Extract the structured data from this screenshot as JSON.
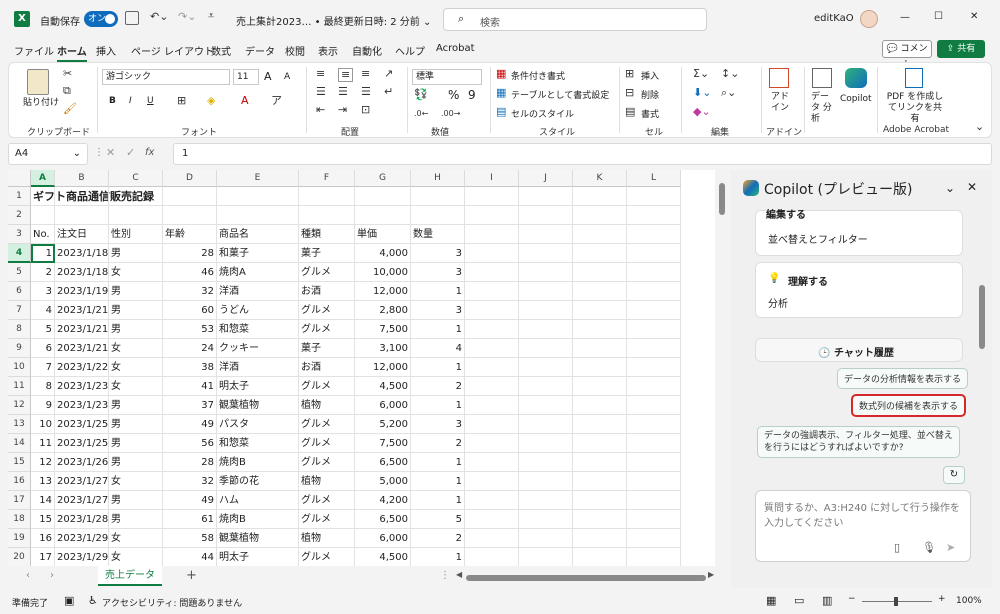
{
  "titlebar": {
    "autosave_label": "自動保存",
    "autosave_state": "オン",
    "doc_title": "売上集計2023… • 最終更新日時: 2 分前 ⌄",
    "search_placeholder": "検索",
    "user_name": "editKaO",
    "min": "—",
    "max": "☐",
    "close": "✕"
  },
  "menu": {
    "items": [
      "ファイル",
      "ホーム",
      "挿入",
      "ページ レイアウト",
      "数式",
      "データ",
      "校閲",
      "表示",
      "自動化",
      "ヘルプ",
      "Acrobat"
    ],
    "comment": "コメント",
    "share": "共有"
  },
  "ribbon": {
    "clipboard": {
      "paste": "貼り付け",
      "label": "クリップボード"
    },
    "font": {
      "name": "游ゴシック",
      "size": "11",
      "label": "フォント",
      "bold": "B",
      "italic": "I",
      "underline": "U",
      "grow": "A",
      "shrink": "A"
    },
    "alignment": {
      "label": "配置"
    },
    "number": {
      "format": "標準",
      "label": "数値",
      "percent": "%",
      "comma": "9"
    },
    "styles": {
      "conditional": "条件付き書式",
      "table": "テーブルとして書式設定",
      "cell_styles": "セルのスタイル",
      "label": "スタイル"
    },
    "cells": {
      "insert": "挿入",
      "delete": "削除",
      "format": "書式",
      "label": "セル"
    },
    "editing": {
      "label": "編集"
    },
    "ideas": {
      "label": "アドイン",
      "button": "アド イン"
    },
    "analysis": {
      "button": "データ 分析"
    },
    "copilot": {
      "button": "Copilot"
    },
    "acrobat": {
      "button": "PDF を作成し てリンクを共有",
      "label": "Adobe Acrobat"
    }
  },
  "formula_bar": {
    "name_box": "A4",
    "fx": "fx",
    "value": "1"
  },
  "grid": {
    "columns": [
      "A",
      "B",
      "C",
      "D",
      "E",
      "F",
      "G",
      "H",
      "I",
      "J",
      "K",
      "L"
    ],
    "title": "ギフト商品通信販売記録",
    "headers": [
      "No.",
      "注文日",
      "性別",
      "年齢",
      "商品名",
      "種類",
      "単価",
      "数量"
    ],
    "rows": [
      [
        "1",
        "2023/1/18",
        "男",
        "28",
        "和菓子",
        "菓子",
        "4,000",
        "3"
      ],
      [
        "2",
        "2023/1/18",
        "女",
        "46",
        "焼肉A",
        "グルメ",
        "10,000",
        "3"
      ],
      [
        "3",
        "2023/1/19",
        "男",
        "32",
        "洋酒",
        "お酒",
        "12,000",
        "1"
      ],
      [
        "4",
        "2023/1/21",
        "男",
        "60",
        "うどん",
        "グルメ",
        "2,800",
        "3"
      ],
      [
        "5",
        "2023/1/21",
        "男",
        "53",
        "和惣菜",
        "グルメ",
        "7,500",
        "1"
      ],
      [
        "6",
        "2023/1/21",
        "女",
        "24",
        "クッキー",
        "菓子",
        "3,100",
        "4"
      ],
      [
        "7",
        "2023/1/22",
        "女",
        "38",
        "洋酒",
        "お酒",
        "12,000",
        "1"
      ],
      [
        "8",
        "2023/1/23",
        "女",
        "41",
        "明太子",
        "グルメ",
        "4,500",
        "2"
      ],
      [
        "9",
        "2023/1/23",
        "男",
        "37",
        "観葉植物",
        "植物",
        "6,000",
        "1"
      ],
      [
        "10",
        "2023/1/25",
        "男",
        "49",
        "パスタ",
        "グルメ",
        "5,200",
        "3"
      ],
      [
        "11",
        "2023/1/25",
        "男",
        "56",
        "和惣菜",
        "グルメ",
        "7,500",
        "2"
      ],
      [
        "12",
        "2023/1/26",
        "男",
        "28",
        "焼肉B",
        "グルメ",
        "6,500",
        "1"
      ],
      [
        "13",
        "2023/1/27",
        "女",
        "32",
        "季節の花",
        "植物",
        "5,000",
        "1"
      ],
      [
        "14",
        "2023/1/27",
        "男",
        "49",
        "ハム",
        "グルメ",
        "4,200",
        "1"
      ],
      [
        "15",
        "2023/1/28",
        "男",
        "61",
        "焼肉B",
        "グルメ",
        "6,500",
        "5"
      ],
      [
        "16",
        "2023/1/29",
        "女",
        "58",
        "観葉植物",
        "植物",
        "6,000",
        "2"
      ],
      [
        "17",
        "2023/1/29",
        "女",
        "44",
        "明太子",
        "グルメ",
        "4,500",
        "1"
      ]
    ],
    "row_numbers": [
      "1",
      "2",
      "3",
      "4",
      "5",
      "6",
      "7",
      "8",
      "9",
      "10",
      "11",
      "12",
      "13",
      "14",
      "15",
      "16",
      "17",
      "18",
      "19",
      "20"
    ]
  },
  "sheet_tabs": {
    "active": "売上データ",
    "add": "+"
  },
  "status": {
    "ready": "準備完了",
    "accessibility": "アクセシビリティ: 問題ありません",
    "zoom": "100%"
  },
  "copilot": {
    "title": "Copilot (プレビュー版)",
    "card_edit_title": "編集する",
    "card_edit_desc": "並べ替えとフィルター",
    "card_understand_title": "理解する",
    "card_understand_desc": "分析",
    "history": "チャット履歴",
    "chip1": "データの分析情報を表示する",
    "chip2": "数式列の候補を表示する",
    "chip3_line1": "データの強調表示、フィルター処理、並べ替え",
    "chip3_line2": "を行うにはどうすればよいですか?",
    "input_placeholder_line1": "質問するか、A3:H240 に対して行う操作を",
    "input_placeholder_line2": "入力してください"
  }
}
